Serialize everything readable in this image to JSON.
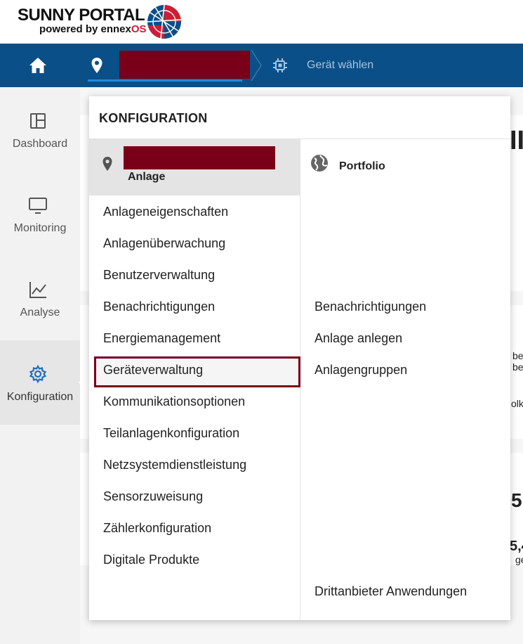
{
  "logo": {
    "title": "SUNNY PORTAL",
    "subtitle_prefix": "powered by ennex",
    "subtitle_os": "OS"
  },
  "topnav": {
    "device_label": "Gerät wählen"
  },
  "sidebar": {
    "items": [
      {
        "label": "Dashboard",
        "icon": "dashboard-icon"
      },
      {
        "label": "Monitoring",
        "icon": "monitor-icon"
      },
      {
        "label": "Analyse",
        "icon": "chart-icon"
      },
      {
        "label": "Konfiguration",
        "icon": "gear-icon",
        "active": true
      }
    ]
  },
  "panel": {
    "title": "KONFIGURATION",
    "anlage_label": "Anlage",
    "portfolio_label": "Portfolio",
    "left_items": [
      "Anlageneigenschaften",
      "Anlagenüberwachung",
      "Benutzerverwaltung",
      "Benachrichtigungen",
      "Energiemanagement",
      "Geräteverwaltung",
      "Kommunikationsoptionen",
      "Teilanlagenkonfiguration",
      "Netzsystemdienstleistung",
      "Sensorzuweisung",
      "Zählerkonfiguration",
      "Digitale Produkte"
    ],
    "right_items": [
      "Benachrichtigungen",
      "Anlage anlegen",
      "Anlagengruppen",
      "Drittanbieter Anwendungen"
    ],
    "highlighted_item": "Geräteverwaltung"
  },
  "background": {
    "fragments": [
      "II",
      "be",
      "be",
      "olk",
      "5",
      "5,4",
      "ge"
    ]
  },
  "colors": {
    "nav_blue": "#0a4f87",
    "accent_blue": "#1f8ce0",
    "redacted": "#7a0019",
    "highlight_border": "#7a0019",
    "brand_red": "#d01c34"
  }
}
